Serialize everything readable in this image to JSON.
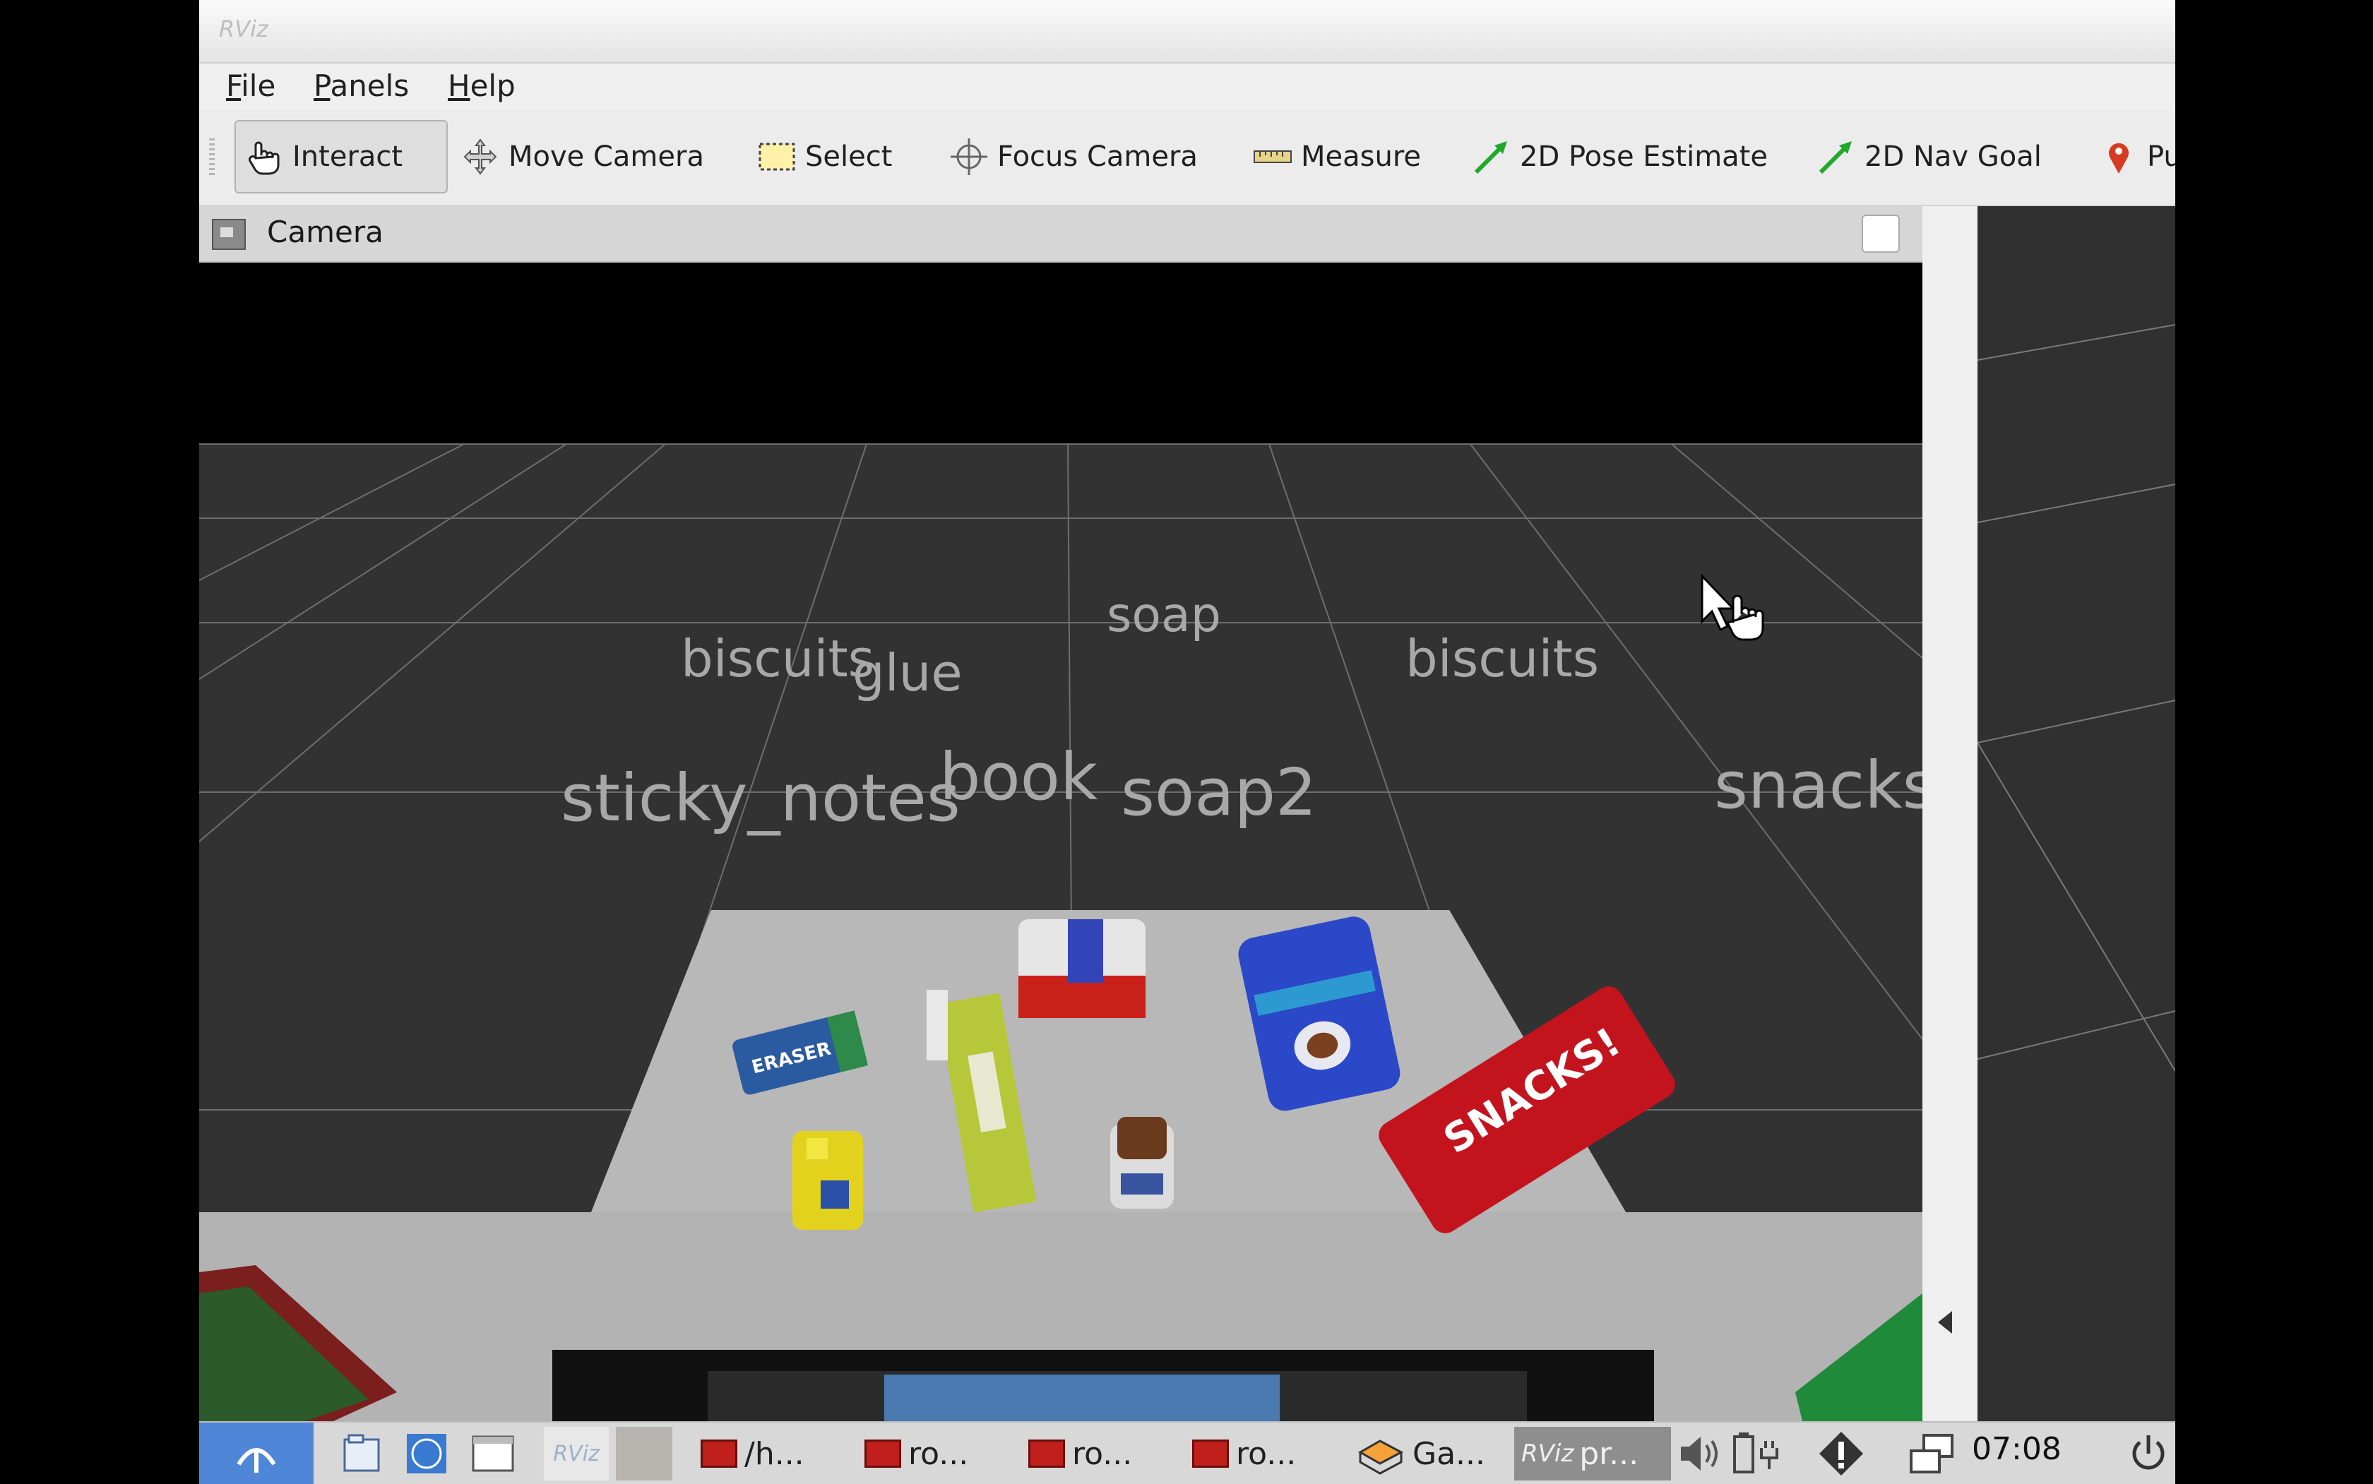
{
  "window": {
    "app_icon_text": "RViz"
  },
  "menu": {
    "file": "File",
    "panels": "Panels",
    "help": "Help"
  },
  "toolbar": {
    "interact": "Interact",
    "move_camera": "Move Camera",
    "select": "Select",
    "focus_camera": "Focus Camera",
    "measure": "Measure",
    "pose_estimate": "2D Pose Estimate",
    "nav_goal": "2D Nav Goal",
    "publish_point": "Pu"
  },
  "camera_panel": {
    "title": "Camera"
  },
  "scene_labels": {
    "biscuits_left": "biscuits",
    "glue": "glue",
    "soap": "soap",
    "biscuits_right": "biscuits",
    "sticky_notes": "sticky_notes",
    "book": "book",
    "soap2": "soap2",
    "snacks": "snacks"
  },
  "objects": {
    "eraser": "ERASER",
    "snacks_box": "SNACKS!"
  },
  "taskbar": {
    "item1": "/h...",
    "item2": "ro...",
    "item3": "ro...",
    "item4": "ro...",
    "item5": "Ga...",
    "item6": "pr...",
    "rviz_badge": "RViz",
    "clock": "07:08"
  },
  "colors": {
    "grid_bg": "#323232",
    "table": "#b4b4b4",
    "label": "#aaaaaa"
  }
}
